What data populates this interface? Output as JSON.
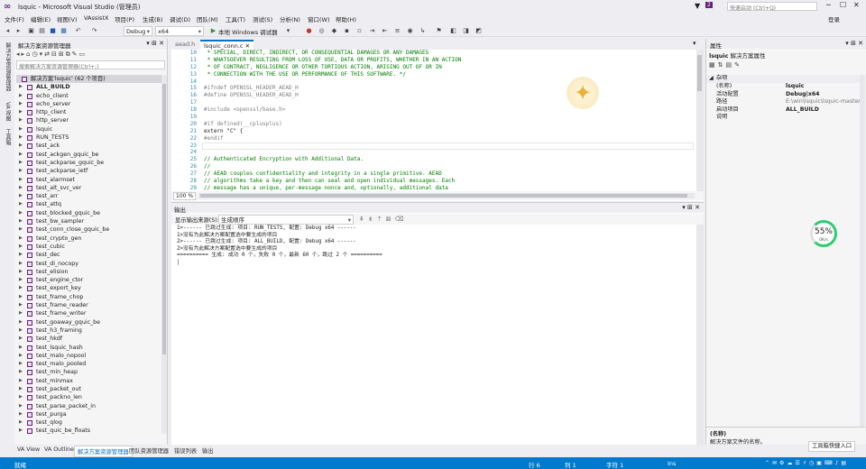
{
  "window": {
    "title": "lsquic - Microsoft Visual Studio (管理员)",
    "quicklaunch_placeholder": "快速启动 (Ctrl+Q)",
    "signin": "登录",
    "notification_count": "2"
  },
  "menu": [
    "文件(F)",
    "编辑(E)",
    "视图(V)",
    "VAssistX",
    "项目(P)",
    "生成(B)",
    "调试(D)",
    "团队(M)",
    "工具(T)",
    "测试(S)",
    "分析(N)",
    "窗口(W)",
    "帮助(H)"
  ],
  "toolbar": {
    "config": "Debug",
    "platform": "x64",
    "debugger": "本地 Windows 调试器"
  },
  "left_strip_tabs": [
    "解决方案资源管理器",
    "VA 视图",
    "工具箱"
  ],
  "solution_explorer": {
    "title": "解决方案资源管理器",
    "search_placeholder": "搜索解决方案资源管理器(Ctrl+;)",
    "root": "解决方案'lsquic' (62 个项目)",
    "items": [
      "ALL_BUILD",
      "echo_client",
      "echo_server",
      "http_client",
      "http_server",
      "lsquic",
      "RUN_TESTS",
      "test_ack",
      "test_ackgen_gquic_be",
      "test_ackparse_gquic_be",
      "test_ackparse_ietf",
      "test_alarmset",
      "test_alt_svc_ver",
      "test_arr",
      "test_attq",
      "test_blocked_gquic_be",
      "test_bw_sampler",
      "test_conn_close_gquic_be",
      "test_crypto_gen",
      "test_cubic",
      "test_dec",
      "test_di_nocopy",
      "test_elision",
      "test_engine_ctor",
      "test_export_key",
      "test_frame_chop",
      "test_frame_reader",
      "test_frame_writer",
      "test_goaway_gquic_be",
      "test_h3_framing",
      "test_hkdf",
      "test_lsquic_hash",
      "test_malo_nopool",
      "test_malo_pooled",
      "test_min_heap",
      "test_minmax",
      "test_packet_out",
      "test_packno_len",
      "test_parse_packet_in",
      "test_purga",
      "test_qlog",
      "test_quic_be_floats"
    ]
  },
  "bottom_tabs": [
    "VA View",
    "VA Outline",
    "解决方案资源管理器",
    "团队资源管理器",
    "错误列表",
    "输出"
  ],
  "editor": {
    "tabs": [
      "aead.h",
      "lsquic_conn.c"
    ],
    "zoom": "100 %",
    "lines": [
      {
        "n": "10",
        "t": " * SPECIAL, DIRECT, INDIRECT, OR CONSEQUENTIAL DAMAGES OR ANY DAMAGES",
        "c": "cm"
      },
      {
        "n": "11",
        "t": " * WHATSOEVER RESULTING FROM LOSS OF USE, DATA OR PROFITS, WHETHER IN AN ACTION",
        "c": "cm"
      },
      {
        "n": "12",
        "t": " * OF CONTRACT, NEGLIGENCE OR OTHER TORTIOUS ACTION, ARISING OUT OF OR IN",
        "c": "cm"
      },
      {
        "n": "13",
        "t": " * CONNECTION WITH THE USE OR PERFORMANCE OF THIS SOFTWARE. */",
        "c": "cm"
      },
      {
        "n": "14",
        "t": "",
        "c": ""
      },
      {
        "n": "15",
        "t": "#ifndef OPENSSL_HEADER_AEAD_H",
        "c": "pp"
      },
      {
        "n": "16",
        "t": "#define OPENSSL_HEADER_AEAD_H",
        "c": "pp"
      },
      {
        "n": "17",
        "t": "",
        "c": ""
      },
      {
        "n": "18",
        "t": "#include <openssl/base.h>",
        "c": "pp"
      },
      {
        "n": "19",
        "t": "",
        "c": ""
      },
      {
        "n": "20",
        "t": "#if defined(__cplusplus)",
        "c": "pp"
      },
      {
        "n": "21",
        "t": "extern \"C\" {",
        "c": ""
      },
      {
        "n": "22",
        "t": "#endif",
        "c": "pp"
      },
      {
        "n": "23",
        "t": "",
        "c": ""
      },
      {
        "n": "24",
        "t": "",
        "c": ""
      },
      {
        "n": "25",
        "t": "// Authenticated Encryption with Additional Data.",
        "c": "cm"
      },
      {
        "n": "26",
        "t": "//",
        "c": "cm"
      },
      {
        "n": "27",
        "t": "// AEAD couples confidentiality and integrity in a single primitive. AEAD",
        "c": "cm"
      },
      {
        "n": "28",
        "t": "// algorithms take a key and then can seal and open individual messages. Each",
        "c": "cm"
      },
      {
        "n": "29",
        "t": "// message has a unique, per-message nonce and, optionally, additional data",
        "c": "cm"
      }
    ]
  },
  "output": {
    "title": "输出",
    "source_label": "显示输出来源(S):",
    "source_value": "生成顺序",
    "lines": [
      "1>------ 已跳过生成: 项目: RUN_TESTS, 配置: Debug x64 ------",
      "1>没有为此解决方案配置选中要生成的项目",
      "2>------ 已跳过生成: 项目: ALL_BUILD, 配置: Debug x64 ------",
      "2>没有为此解决方案配置选中要生成的项目",
      "========== 生成: 成功 0 个，失败 0 个，最新 60 个，跳过 2 个 =========="
    ]
  },
  "properties": {
    "title": "属性",
    "object": "lsquic",
    "object_type": "解决方案属性",
    "category": "杂项",
    "rows": [
      {
        "k": "(名称)",
        "v": "lsquic",
        "bold": true
      },
      {
        "k": "活动配置",
        "v": "Debug|x64",
        "bold": true
      },
      {
        "k": "路径",
        "v": "E:\\win\\lsquic\\lsquic-master\\",
        "bold": false
      },
      {
        "k": "启动项目",
        "v": "ALL_BUILD",
        "bold": true
      },
      {
        "k": "说明",
        "v": "",
        "bold": false
      }
    ],
    "desc_title": "(名称)",
    "desc_text": "解决方案文件的名称。"
  },
  "widgets": {
    "gauge_pct": "55%",
    "gauge_speed": "0K/s",
    "task_entry": "工具箱快捷入口"
  },
  "status": {
    "ready": "就绪",
    "line": "行 6",
    "col": "列 1",
    "char": "字符 1",
    "mode": "Ins"
  }
}
